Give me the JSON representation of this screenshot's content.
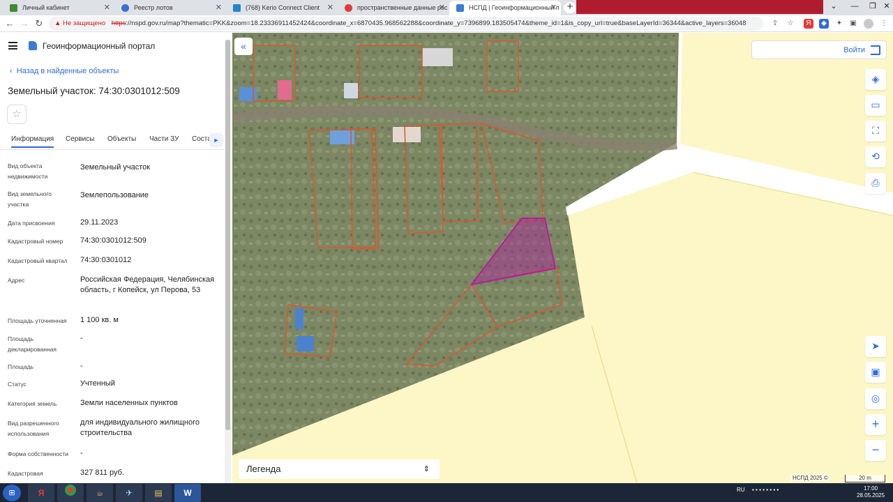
{
  "browser": {
    "tabs": [
      {
        "label": "Личный кабинет",
        "icon": "cabinet-favicon",
        "color": "#3c8d2f"
      },
      {
        "label": "Реестр лотов",
        "icon": "registry-favicon",
        "color": "#3a6fd8"
      },
      {
        "label": "(768) Kerio Connect Client",
        "icon": "kerio-favicon",
        "color": "#1e88c7"
      },
      {
        "label": "пространственные данные рос",
        "icon": "yandex-favicon",
        "color": "#e53935"
      },
      {
        "label": "НСПД | Геоинформационный п",
        "icon": "nspd-favicon",
        "color": "#3a7bd5"
      }
    ],
    "address": {
      "security_label": "Не защищено",
      "scheme": "https",
      "url_rest": "://nspd.gov.ru/map?thematic=PKK&zoom=18.23336911452424&coordinate_x=6870435.968562288&coordinate_y=7396899.183505474&theme_id=1&is_copy_url=true&baseLayerId=36344&active_layers=36048"
    }
  },
  "panel": {
    "portal_name": "Геоинформационный портал",
    "back_link": "Назад в найденные объекты",
    "title": "Земельный участок: 74:30:0301012:509",
    "tabs": [
      "Информация",
      "Сервисы",
      "Объекты",
      "Части ЗУ",
      "Соста"
    ],
    "active_tab": "Информация",
    "fields": [
      {
        "label": "Вид объекта недвижимости",
        "value": "Земельный участок"
      },
      {
        "label": "Вид земельного участка",
        "value": "Землепользование"
      },
      {
        "label": "Дата присвоения",
        "value": "29.11.2023"
      },
      {
        "label": "Кадастровый номер",
        "value": "74:30:0301012:509"
      },
      {
        "label": "Кадастровый квартал",
        "value": "74:30:0301012"
      },
      {
        "label": "Адрес",
        "value": "Российская Федерация, Челябинская область, г Копейск, ул Перова, 53"
      },
      {
        "label": "Площадь уточненная",
        "value": "1 100 кв. м"
      },
      {
        "label": "Площадь декларированная",
        "value": "-"
      },
      {
        "label": "Площадь",
        "value": "-"
      },
      {
        "label": "Статус",
        "value": "Учтенный"
      },
      {
        "label": "Категория земель",
        "value": "Земли населенных пунктов"
      },
      {
        "label": "Вид разрешенного использования",
        "value": "для индивидуального жилищного строительства"
      },
      {
        "label": "Форма собственности",
        "value": "-"
      },
      {
        "label": "Кадастровая",
        "value": "327 811 руб."
      }
    ]
  },
  "map": {
    "login_label": "Войти",
    "legend_label": "Легенда",
    "attribution": "НСПД 2025 ©",
    "scale_label": "20 m",
    "zoom_in": "+",
    "zoom_out": "−",
    "selected_parcel_color": "#b0209e",
    "parcel_border_color": "#d9572e",
    "zone_fill_color": "#fdf6c7"
  },
  "taskbar": {
    "language": "RU",
    "time": "17:00",
    "date": "28.05.2025"
  }
}
